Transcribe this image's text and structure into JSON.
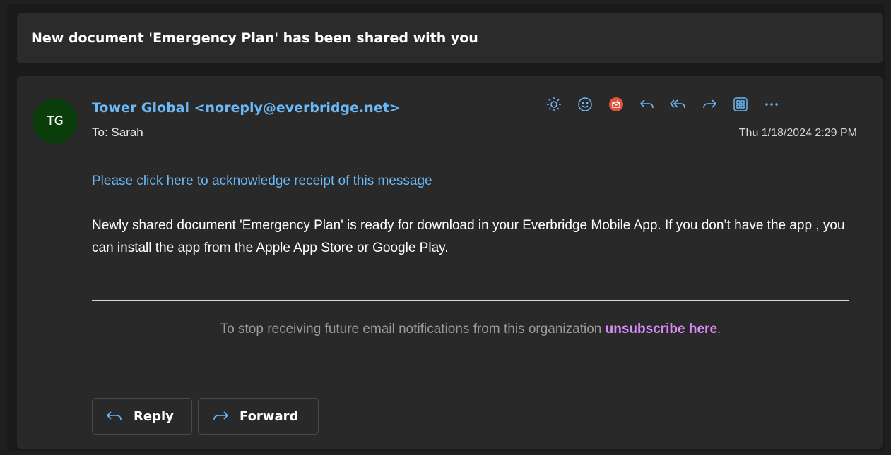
{
  "subject": "New document 'Emergency Plan' has been shared with you",
  "message": {
    "avatar_initials": "TG",
    "sender": "Tower Global <noreply@everbridge.net>",
    "to_line": "To:  Sarah",
    "date": "Thu 1/18/2024 2:29 PM",
    "acknowledge_link": "Please click here to acknowledge receipt of this message",
    "body": "Newly shared document 'Emergency Plan' is ready for download in your Everbridge Mobile App. If you don’t have the app , you can install the app from the Apple App Store or Google Play.",
    "unsubscribe_prefix": "To stop receiving future email notifications from this organization ",
    "unsubscribe_link": "unsubscribe here",
    "unsubscribe_suffix": "."
  },
  "toolbar": {
    "icons": [
      "brightness-icon",
      "emoji-icon",
      "report-icon",
      "reply-icon",
      "reply-all-icon",
      "forward-icon",
      "apps-icon",
      "more-icon"
    ]
  },
  "actions": {
    "reply_label": "Reply",
    "forward_label": "Forward"
  },
  "colors": {
    "accent_link": "#6cb8f6",
    "unsubscribe_link": "#d68bf6",
    "avatar_bg": "#0b3d0b",
    "report_icon": "#e0533a"
  }
}
